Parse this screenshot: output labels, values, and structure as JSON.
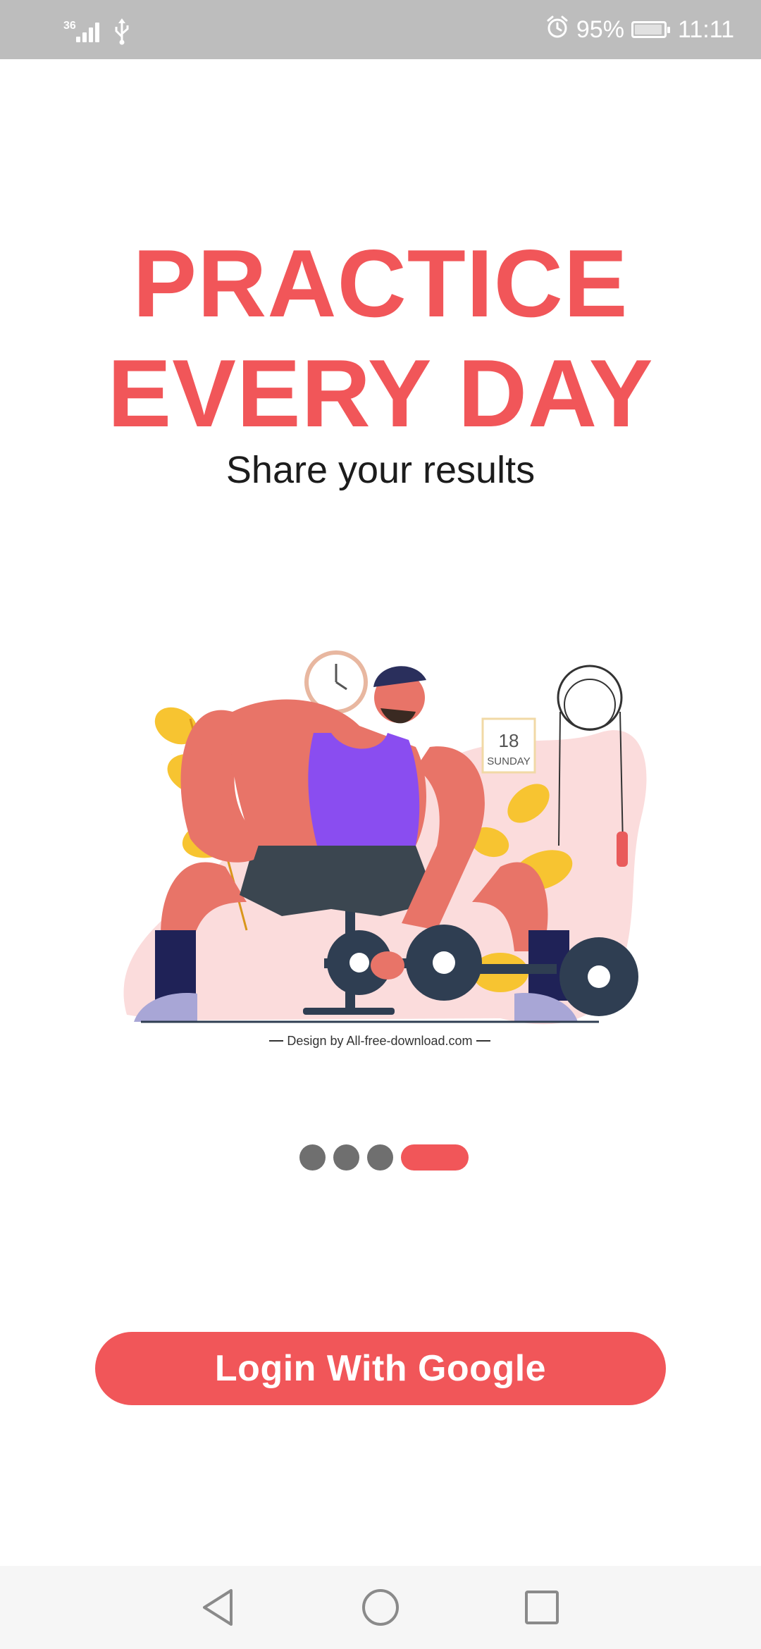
{
  "status_bar": {
    "network_label": "36",
    "battery_percent": "95%",
    "battery_level": 0.95,
    "time": "11:11"
  },
  "onboarding": {
    "headline_line1": "PRACTICE",
    "headline_line2": "EVERY DAY",
    "subtitle": "Share your results",
    "illustration_credit": "Design by All-free-download.com",
    "calendar_day": "18",
    "calendar_weekday": "SUNDAY",
    "page_count": 4,
    "current_page": 4
  },
  "actions": {
    "login_label": "Login With Google"
  },
  "theme": {
    "accent": "#f15659",
    "status_bar_bg": "#bdbdbd",
    "inactive_dot": "#6f6f6f"
  },
  "icons": {
    "nav_back": "triangle-back-icon",
    "nav_home": "circle-home-icon",
    "nav_recents": "square-recents-icon"
  }
}
